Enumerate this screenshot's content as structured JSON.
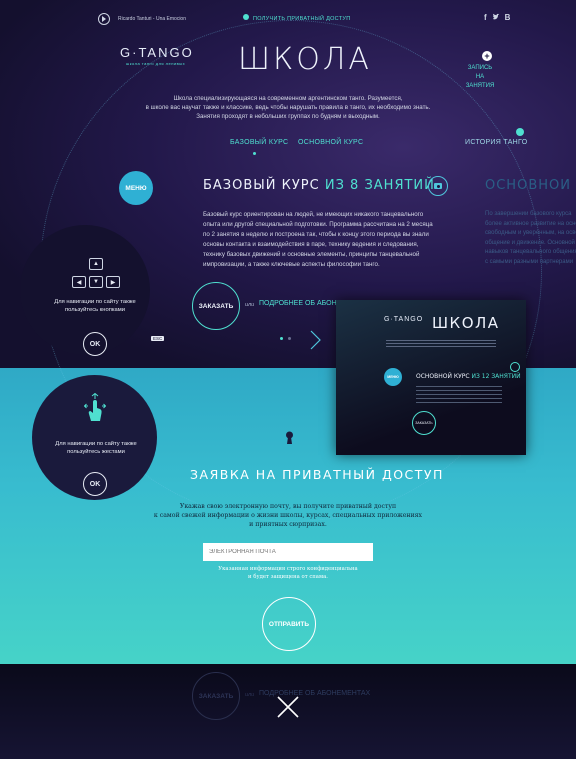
{
  "header": {
    "artist": "Ricardo Tanturi - Una Emocion",
    "private_access": "ПОЛУЧИТЬ ПРИВАТНЫЙ ДОСТУП",
    "social": [
      "f",
      "t",
      "B"
    ]
  },
  "logo": {
    "name": "G·TANGO",
    "tagline": "школа танго для ленивых"
  },
  "page": {
    "title": "ШКОЛА",
    "intro": [
      "Школа специализирующаяся на современном аргентинском танго. Разумеется,",
      "в школе вас научат также и классике, ведь чтобы нарушать правила в танго, их необходимо знать.",
      "Занятия проходят в небольших группах по будням и выходным."
    ]
  },
  "signup": {
    "line1": "ЗАПИСЬ",
    "line2": "НА ЗАНЯТИЯ"
  },
  "tabs": [
    {
      "label": "БАЗОВЫЙ КУРС",
      "active": true
    },
    {
      "label": "ОСНОВНОЙ КУРС",
      "active": false
    },
    {
      "label": "ИСТОРИЯ ТАНГО",
      "active": false
    }
  ],
  "menu_label": "МЕНЮ",
  "course": {
    "title_a": "БАЗОВЫЙ КУРС",
    "title_b": "ИЗ 8 ЗАНЯТИЙ",
    "description": [
      "Базовый курс ориентирован на людей, не имеющих никакого танцевального",
      "опыта или другой специальной подготовки. Программа рассчитана на 2 месяца",
      "по 2 занятия в неделю и построена так, чтобы к концу этого периода вы знали",
      "основы контакта и взаимодействия в паре, технику ведения и следования,",
      "технику базовых движений и основные элементы, принципы танцевальной",
      "импровизации, а также ключевые аспекты философии танго."
    ],
    "order": "ЗАКАЗАТЬ",
    "or": "или",
    "details": "ПОДРОБНЕЕ ОБ АБОНЕМЕНТАХ"
  },
  "next_course": {
    "title": "ОСНОВНОЙ УРОВЕНЬ",
    "lines": [
      "По завершении базового курса",
      "более активное развитие на основе",
      "свободным и уверенным, на освоение",
      "общение и движение. Основной",
      "навыков танцевального общения",
      "с самыми разными партнерами"
    ]
  },
  "nav_help": {
    "keys_text": [
      "Для навигации по сайту также",
      "пользуйтесь кнопками"
    ],
    "ok": "OK",
    "esc": "ESC",
    "gestures_text": [
      "Для навигации по сайту также",
      "пользуйтесь жестами"
    ]
  },
  "mini_preview": {
    "logo": "G·TANGO",
    "title": "ШКОЛА",
    "course_a": "ОСНОВНОЙ КУРС",
    "course_b": "ИЗ 12 ЗАНЯТИЙ",
    "menu": "МЕНЮ",
    "order": "ЗАКАЗАТЬ"
  },
  "request": {
    "title": "ЗАЯВКА НА ПРИВАТНЫЙ ДОСТУП",
    "text": [
      "Укажав свою электронную почту, вы получите приватный доступ",
      "к самой свежей информации о жизни школы, курсах, специальных приложениях",
      "и приятных сюрпризах."
    ],
    "email_placeholder": "ЭЛЕКТРОННАЯ ПОЧТА",
    "note": [
      "Указанная информация строго конфиденциальна",
      "и будет защищена от спама."
    ],
    "send": "ОТПРАВИТЬ"
  },
  "footer": {
    "order": "ЗАКАЗАТЬ",
    "or": "или",
    "details": "ПОДРОБНЕЕ ОБ АБОНЕМЕНТАХ"
  },
  "colors": {
    "accent": "#4fe0d0",
    "bg": "#1a1640",
    "gradient_top": "#2fa9c6",
    "gradient_bottom": "#46d3c8"
  }
}
